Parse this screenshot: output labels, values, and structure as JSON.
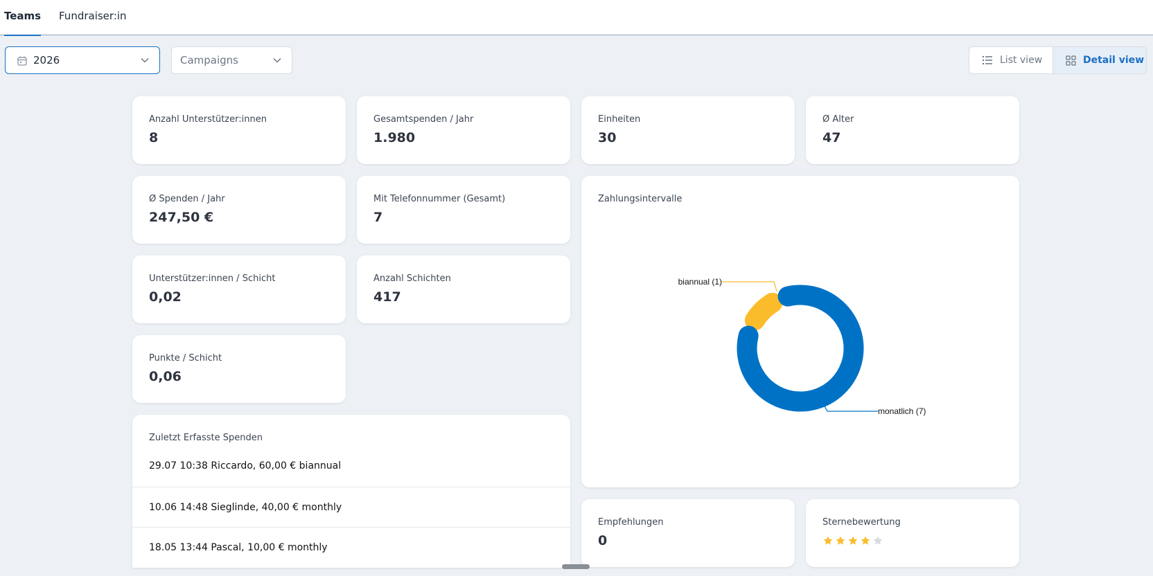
{
  "tabs": [
    {
      "label": "Teams",
      "active": true
    },
    {
      "label": "Fundraiser:in",
      "active": false
    }
  ],
  "filters": {
    "year": "2026",
    "campaigns_placeholder": "Campaigns"
  },
  "view_toggle": {
    "list_label": "List view",
    "detail_label": "Detail view",
    "selected": "Detail view"
  },
  "stats": {
    "supporters": {
      "label": "Anzahl Unterstützer:innen",
      "value": "8"
    },
    "total_donations": {
      "label": "Gesamtspenden / Jahr",
      "value": "1.980"
    },
    "units": {
      "label": "Einheiten",
      "value": "30"
    },
    "avg_age": {
      "label": "Ø Alter",
      "value": "47"
    },
    "avg_donation": {
      "label": "Ø Spenden / Jahr",
      "value": "247,50 €"
    },
    "with_phone": {
      "label": "Mit Telefonnummer (Gesamt)",
      "value": "7"
    },
    "supporters_per_shift": {
      "label": "Unterstützer:innen / Schicht",
      "value": "0,02"
    },
    "shifts": {
      "label": "Anzahl Schichten",
      "value": "417"
    },
    "points_per_shift": {
      "label": "Punkte / Schicht",
      "value": "0,06"
    },
    "referrals": {
      "label": "Empfehlungen",
      "value": "0"
    }
  },
  "payment_intervals": {
    "title": "Zahlungsintervalle",
    "chart_data": {
      "type": "pie",
      "donut": true,
      "categories": [
        "biannual",
        "monatlich"
      ],
      "values": [
        1,
        7
      ],
      "labels": [
        "biannual (1)",
        "monatlich (7)"
      ],
      "colors": [
        "#fbbc2c",
        "#0072c6"
      ]
    }
  },
  "recent_donations": {
    "title": "Zuletzt Erfasste Spenden",
    "items": [
      "29.07 10:38 Riccardo, 60,00 € biannual",
      "10.06 14:48 Sieglinde, 40,00 € monthly",
      "18.05 13:44 Pascal, 10,00 € monthly"
    ]
  },
  "rating": {
    "label": "Sternebewertung",
    "value": 4,
    "max": 5
  },
  "colors": {
    "accent": "#1b6fc4",
    "star_filled": "#fbbc2c",
    "star_empty": "#d5dae0",
    "background": "#edf1f5"
  }
}
